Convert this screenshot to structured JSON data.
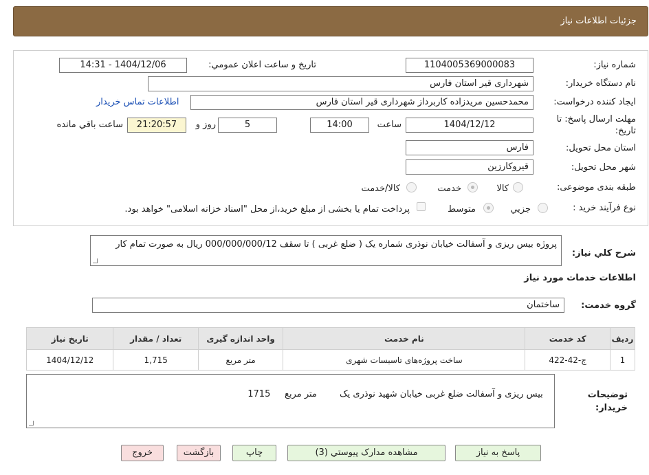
{
  "header": {
    "title": "جزئیات اطلاعات نیاز"
  },
  "form": {
    "need_number_label": "شماره نیاز:",
    "need_number": "1104005369000083",
    "announce_datetime_label": "تاریخ و ساعت اعلان عمومي:",
    "announce_datetime": "1404/12/06 - 14:31",
    "buyer_org_label": "نام دستگاه خریدار:",
    "buyer_org": "شهرداری قیر استان فارس",
    "requester_label": "ایجاد کننده درخواست:",
    "requester": "محمدحسین مریدزاده کاربرداز شهرداری قیر استان فارس",
    "buyer_contact_link": "اطلاعات تماس خریدار",
    "deadline_label_line1": "مهلت ارسال پاسخ: تا",
    "deadline_label_line2": "تاریخ:",
    "deadline_date": "1404/12/12",
    "time_label": "ساعت",
    "deadline_time": "14:00",
    "days_value": "5",
    "days_label": "روز و",
    "remaining_time": "21:20:57",
    "remaining_label": "ساعت باقي مانده",
    "province_label": "استان محل تحویل:",
    "province": "فارس",
    "city_label": "شهر محل تحویل:",
    "city": "قیروکارزین",
    "category_label": "طبقه بندی موضوعی:",
    "category_options": [
      "کالا",
      "خدمت",
      "کالا/خدمت"
    ],
    "category_selected": "خدمت",
    "process_label": "نوع فرآیند خرید :",
    "process_options": [
      "جزيي",
      "متوسط"
    ],
    "process_selected": "متوسط",
    "treasury_note": "پرداخت تمام یا بخشی از مبلغ خرید،از محل \"اسناد خزانه اسلامی\" خواهد بود."
  },
  "description": {
    "label": "شرح كلي نیاز:",
    "text": "پروژه بیس ریزی و  آسفالت خیابان نوذری شماره یک ( ضلع غربی ) تا سقف 000/000/000/12 ریال به صورت تمام کار"
  },
  "services": {
    "section_title": "اطلاعات خدمات مورد نیاز",
    "group_label": "گروه خدمت:",
    "group_value": "ساختمان",
    "columns": [
      "ردیف",
      "کد خدمت",
      "نام خدمت",
      "واحد اندازه گیری",
      "تعداد / مقدار",
      "تاریخ نیاز"
    ],
    "rows": [
      {
        "row": "1",
        "code": "ج-42-422",
        "name": "ساخت پروژه‌های تاسیسات شهری",
        "unit": "متر مربع",
        "qty": "1,715",
        "date": "1404/12/12"
      }
    ]
  },
  "buyer_notes": {
    "label_line1": "توضیحات",
    "label_line2": "خریدار:",
    "text": "بیس ریزی و آسفالت ضلع غربی خیابان شهید نوذری یک        متر مربع     1715"
  },
  "buttons": {
    "reply": "پاسخ به نیاز",
    "attachments": "مشاهده مدارک پیوستي (3)",
    "print": "چاپ",
    "back": "بازگشت",
    "exit": "خروج"
  },
  "colors": {
    "header_bg": "#8b6a43",
    "link": "#1a4fb5",
    "remaining_bg": "#fbf6d1",
    "green_button": "#e6f6dd",
    "pink_button": "#f9dede"
  }
}
